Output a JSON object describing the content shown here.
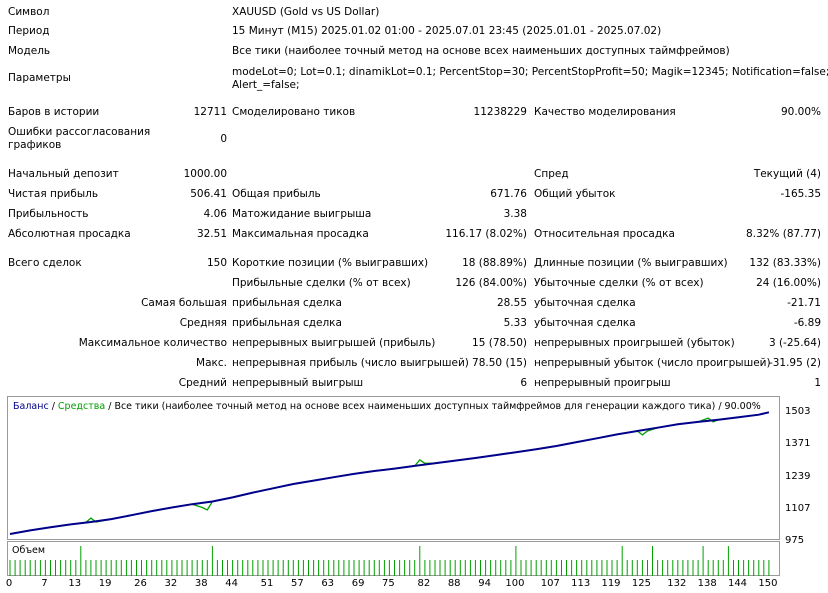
{
  "report": {
    "symbol_label": "Символ",
    "symbol_value": "XAUUSD (Gold vs US Dollar)",
    "period_label": "Период",
    "period_value": "15 Минут (M15) 2025.01.02 01:00 - 2025.07.01 23:45 (2025.01.01 - 2025.07.02)",
    "model_label": "Модель",
    "model_value": "Все тики (наиболее точный метод на основе всех наименьших доступных таймфреймов)",
    "params_label": "Параметры",
    "params_line1": "modeLot=0; Lot=0.1; dinamikLot=0.1; PercentStop=30; PercentStopProfit=50; Magik=12345; Notification=false;",
    "params_line2": "Alert_=false;",
    "bars_label": "Баров в истории",
    "bars_value": "12711",
    "ticks_label": "Смоделировано тиков",
    "ticks_value": "11238229",
    "quality_label": "Качество моделирования",
    "quality_value": "90.00%",
    "errors_label_1": "Ошибки рассогласования",
    "errors_label_2": "графиков",
    "errors_value": "0",
    "deposit_label": "Начальный депозит",
    "deposit_value": "1000.00",
    "spread_label": "Спред",
    "spread_value": "Текущий (4)",
    "net_label": "Чистая прибыль",
    "net_value": "506.41",
    "gross_profit_label": "Общая прибыль",
    "gross_profit_value": "671.76",
    "gross_loss_label": "Общий убыток",
    "gross_loss_value": "-165.35",
    "pf_label": "Прибыльность",
    "pf_value": "4.06",
    "payoff_label": "Матожидание выигрыша",
    "payoff_value": "3.38",
    "abs_dd_label": "Абсолютная просадка",
    "abs_dd_value": "32.51",
    "max_dd_label": "Максимальная просадка",
    "max_dd_value": "116.17 (8.02%)",
    "rel_dd_label": "Относительная просадка",
    "rel_dd_value": "8.32% (87.77)",
    "total_label": "Всего сделок",
    "total_value": "150",
    "short_label": "Короткие позиции (% выигравших)",
    "short_value": "18 (88.89%)",
    "long_label": "Длинные позиции (% выигравших)",
    "long_value": "132 (83.33%)",
    "profit_trades_label": "Прибыльные сделки (% от всех)",
    "profit_trades_value": "126 (84.00%)",
    "loss_trades_label": "Убыточные сделки (% от всех)",
    "loss_trades_value": "24 (16.00%)",
    "largest_label": "Самая большая",
    "largest_profit_label": "прибыльная сделка",
    "largest_profit_value": "28.55",
    "largest_loss_label": "убыточная сделка",
    "largest_loss_value": "-21.71",
    "avg_label": "Средняя",
    "avg_profit_label": "прибыльная сделка",
    "avg_profit_value": "5.33",
    "avg_loss_label": "убыточная сделка",
    "avg_loss_value": "-6.89",
    "maxcount_label": "Максимальное количество",
    "maxcount_wins_label": "непрерывных выигрышей (прибыль)",
    "maxcount_wins_value": "15 (78.50)",
    "maxcount_losses_label": "непрерывных проигрышей (убыток)",
    "maxcount_losses_value": "3 (-25.64)",
    "max_label": "Макс.",
    "max_profit_label": "непрерывная прибыль (число выигрышей)",
    "max_profit_value": "78.50 (15)",
    "max_loss_label": "непрерывный убыток (число проигрышей)",
    "max_loss_value": "-31.95 (2)",
    "avgc_label": "Средний",
    "avgc_wins_label": "непрерывный выигрыш",
    "avgc_wins_value": "6",
    "avgc_losses_label": "непрерывный проигрыш",
    "avgc_losses_value": "1"
  },
  "legend": {
    "balance": "Баланс",
    "sep1": " / ",
    "equity": "Средства",
    "sep2": " / ",
    "rest": "Все тики (наиболее точный метод на основе всех наименьших доступных таймфреймов для генерации каждого тика) / 90.00%"
  },
  "volume_label": "Объем",
  "colors": {
    "balance": "#00008b",
    "equity": "#00a000",
    "volume": "#00a000"
  },
  "chart_data": {
    "type": "line",
    "x_ticks": [
      "0",
      "7",
      "13",
      "19",
      "26",
      "32",
      "38",
      "44",
      "51",
      "57",
      "63",
      "69",
      "75",
      "82",
      "88",
      "94",
      "100",
      "107",
      "113",
      "119",
      "125",
      "132",
      "138",
      "144",
      "150"
    ],
    "y_ticks": [
      "1503",
      "1371",
      "1239",
      "1107",
      "975"
    ],
    "ylim": [
      975,
      1530
    ],
    "xlim": [
      0,
      152
    ],
    "series": [
      {
        "name": "Баланс",
        "x": [
          0,
          4,
          8,
          12,
          16,
          20,
          24,
          28,
          32,
          36,
          40,
          44,
          48,
          52,
          56,
          60,
          64,
          68,
          72,
          76,
          80,
          84,
          88,
          92,
          96,
          100,
          104,
          108,
          112,
          116,
          120,
          124,
          128,
          132,
          136,
          140,
          144,
          148,
          150
        ],
        "y": [
          1000,
          1015,
          1028,
          1040,
          1050,
          1062,
          1078,
          1095,
          1110,
          1124,
          1135,
          1152,
          1172,
          1190,
          1208,
          1222,
          1236,
          1250,
          1262,
          1272,
          1283,
          1294,
          1305,
          1316,
          1328,
          1340,
          1352,
          1366,
          1382,
          1398,
          1414,
          1428,
          1442,
          1456,
          1466,
          1475,
          1485,
          1496,
          1506
        ]
      },
      {
        "name": "Средства",
        "x": [
          0,
          4,
          8,
          12,
          15,
          16,
          17,
          20,
          24,
          28,
          32,
          36,
          38,
          39,
          40,
          44,
          48,
          52,
          56,
          60,
          64,
          68,
          72,
          76,
          80,
          81,
          82,
          84,
          88,
          92,
          96,
          100,
          104,
          108,
          112,
          116,
          120,
          124,
          125,
          126,
          128,
          132,
          136,
          138,
          139,
          140,
          144,
          148,
          150
        ],
        "y": [
          1000,
          1015,
          1028,
          1040,
          1048,
          1066,
          1050,
          1062,
          1078,
          1095,
          1110,
          1124,
          1110,
          1100,
          1135,
          1152,
          1172,
          1190,
          1208,
          1222,
          1236,
          1250,
          1262,
          1272,
          1283,
          1308,
          1294,
          1294,
          1305,
          1316,
          1328,
          1340,
          1352,
          1366,
          1382,
          1398,
          1414,
          1428,
          1412,
          1428,
          1442,
          1456,
          1466,
          1482,
          1466,
          1475,
          1485,
          1496,
          1506
        ]
      }
    ],
    "volume_x": [
      14,
      40,
      81,
      100,
      121,
      127,
      137,
      142
    ]
  }
}
